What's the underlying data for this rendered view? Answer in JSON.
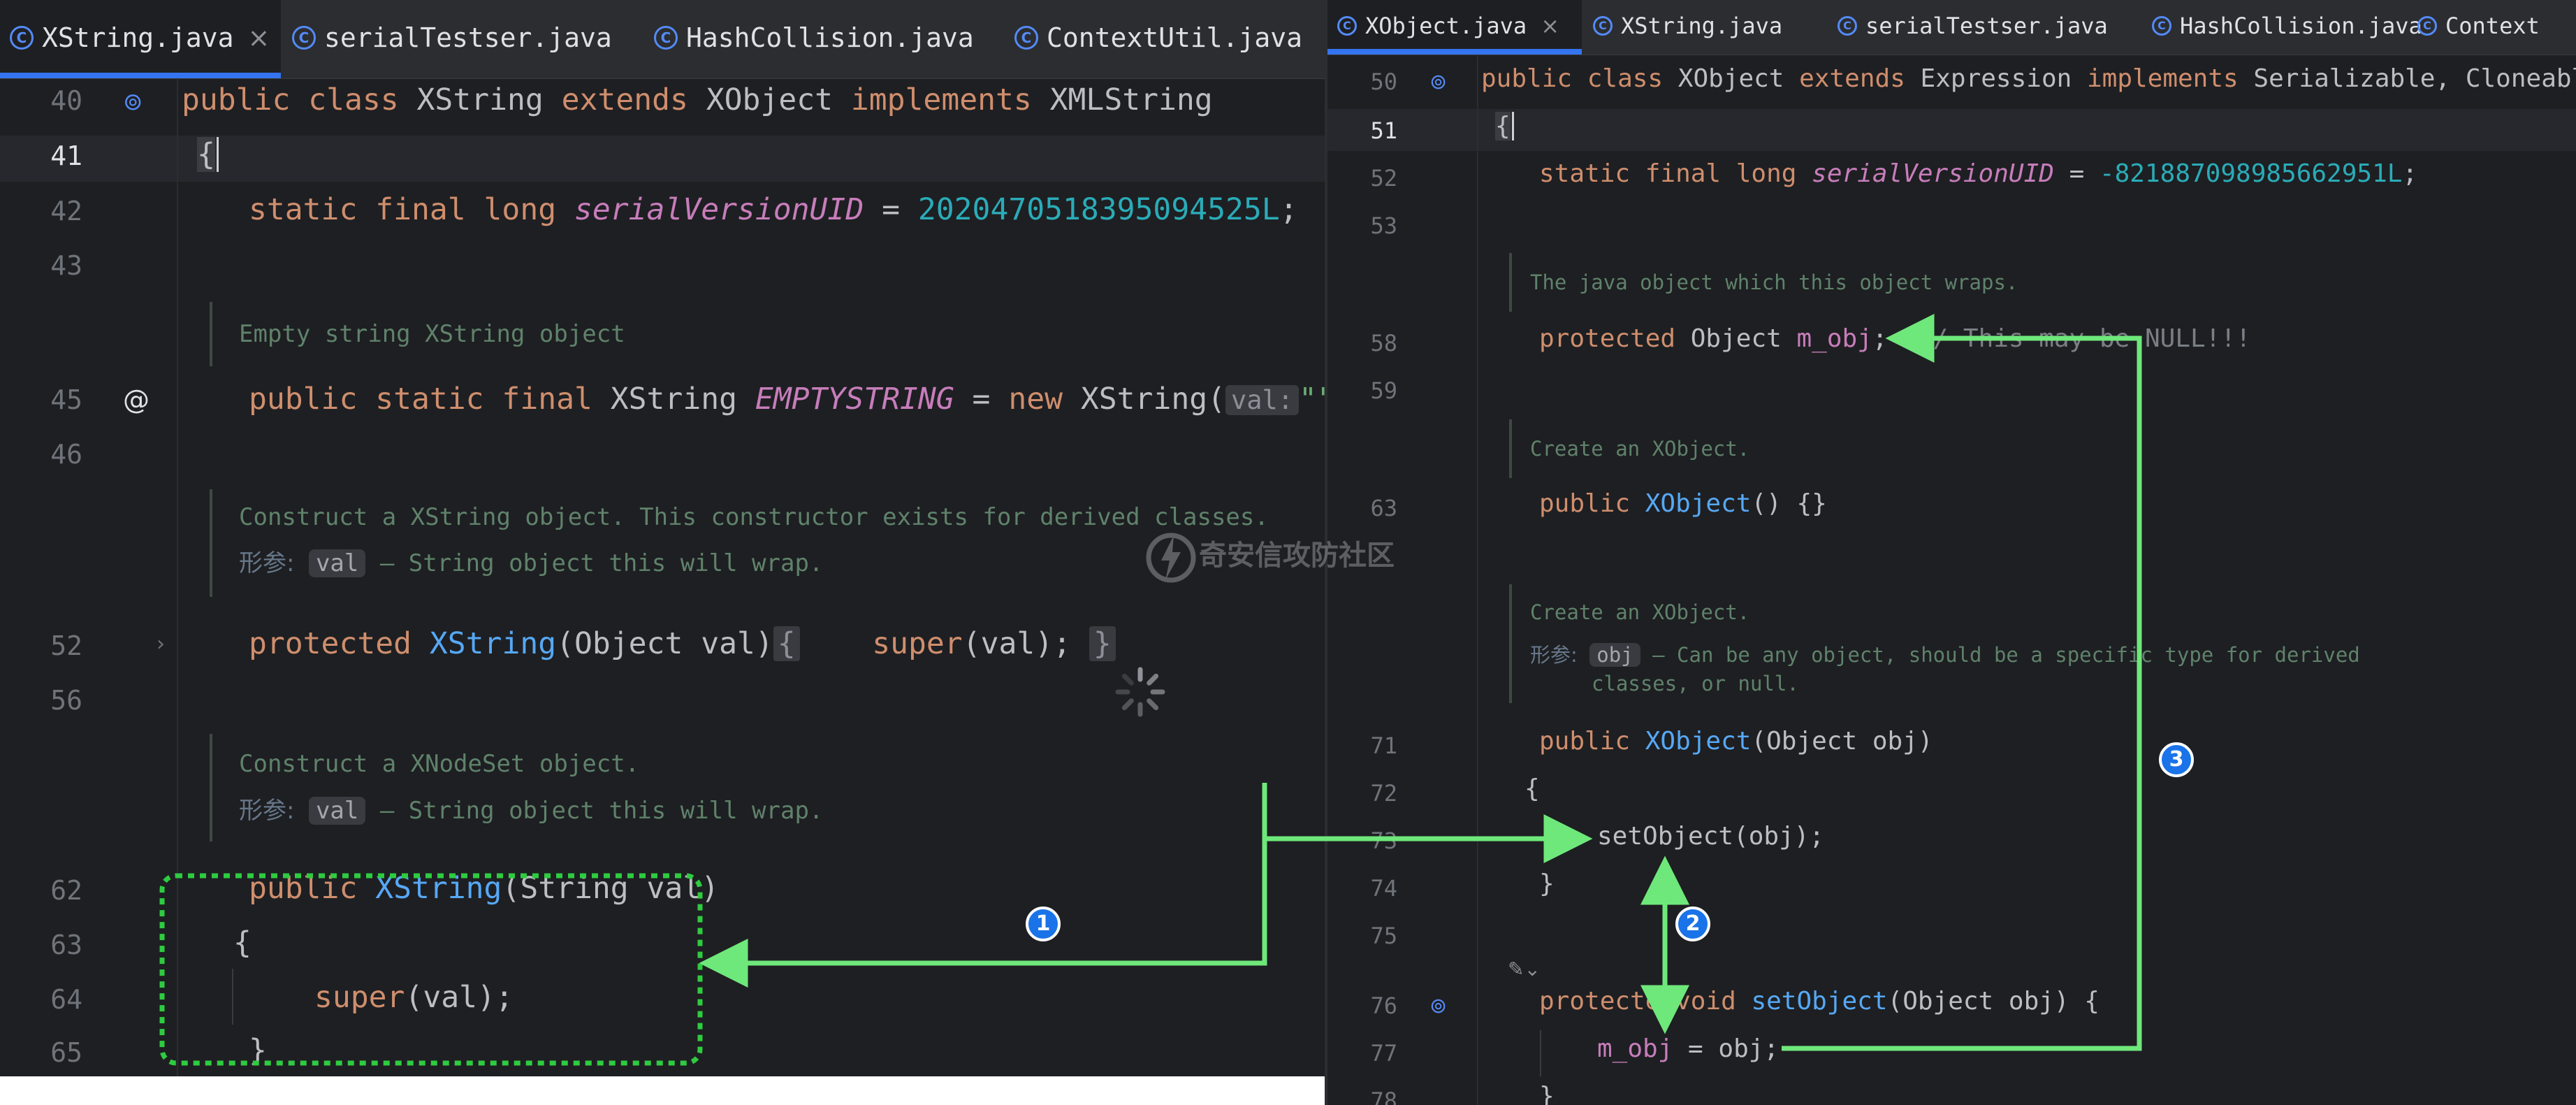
{
  "left_pane": {
    "tabs": [
      {
        "label": "XString.java",
        "icon": "class-c-icon",
        "active": true,
        "closable": true
      },
      {
        "label": "serialTestser.java",
        "icon": "class-c-icon"
      },
      {
        "label": "HashCollision.java",
        "icon": "class-c-icon"
      },
      {
        "label": "ContextUtil.java",
        "icon": "class-c-icon"
      }
    ],
    "close_symbol": "×",
    "line_numbers": [
      "40",
      "41",
      "42",
      "43",
      "45",
      "46",
      "52",
      "56",
      "62",
      "63",
      "64",
      "65"
    ],
    "code": {
      "l40": {
        "kw1": "public class ",
        "name": "XString ",
        "kw2": "extends ",
        "parent": "XObject ",
        "kw3": "implements ",
        "iface": "XMLString"
      },
      "l41": {
        "brace": "{"
      },
      "l42": {
        "kw": "static final long ",
        "field": "serialVersionUID",
        "eq": " = ",
        "num": "2020470518395094525L",
        "semi": ";"
      },
      "l45": {
        "kw1": "public static final ",
        "type": "XString ",
        "field": "EMPTYSTRING",
        "eq": " = ",
        "kw2": "new ",
        "ctor": "XString(",
        "hint": "val:",
        "str": "\"\"",
        "end": ");"
      },
      "l52": {
        "kw": "protected ",
        "fn": "XString",
        "params": "(Object val)",
        "open": "{",
        "call": "super",
        "args": "(val);",
        "close": "}"
      },
      "l62": {
        "kw": "public ",
        "fn": "XString",
        "params": "(String val)"
      },
      "l63": {
        "brace": "{"
      },
      "l64": {
        "call": "super",
        "args": "(val);"
      },
      "l65": {
        "brace": "}"
      }
    },
    "docs": {
      "empty": "Empty string XString object",
      "construct_1": "Construct a XString object. This constructor exists for derived classes.",
      "construct_2": "Construct a XNodeSet object.",
      "param_tag": "形参:",
      "param_name": "val",
      "param_desc": " – String object this will wrap."
    }
  },
  "right_pane": {
    "tabs": [
      {
        "label": "XObject.java",
        "icon": "class-c-icon",
        "active": true,
        "closable": true
      },
      {
        "label": "XString.java",
        "icon": "class-c-icon"
      },
      {
        "label": "serialTestser.java",
        "icon": "class-c-icon"
      },
      {
        "label": "HashCollision.java",
        "icon": "class-c-icon"
      },
      {
        "label": "Context",
        "icon": "class-c-icon"
      }
    ],
    "close_symbol": "×",
    "line_numbers": [
      "50",
      "51",
      "52",
      "53",
      "58",
      "59",
      "63",
      "71",
      "72",
      "73",
      "74",
      "75",
      "76",
      "77",
      "78"
    ],
    "code": {
      "l50": {
        "kw1": "public class ",
        "name": "XObject ",
        "kw2": "extends ",
        "parent": "Expression ",
        "kw3": "implements ",
        "ifaces": "Serializable, Cloneable"
      },
      "l51": {
        "brace": "{"
      },
      "l52": {
        "kw": "static final long ",
        "field": "serialVersionUID",
        "eq": " = ",
        "num": "-821887098985662951L",
        "semi": ";"
      },
      "l58": {
        "kw": "protected ",
        "type": "Object ",
        "field": "m_obj",
        "semi": ";",
        "comment": "  // This may be NULL!!!"
      },
      "l63": {
        "kw": "public ",
        "fn": "XObject",
        "rest": "() {}"
      },
      "l71": {
        "kw": "public ",
        "fn": "XObject",
        "params": "(Object obj)"
      },
      "l72": {
        "brace": "{"
      },
      "l73": {
        "call": "setObject(obj);"
      },
      "l74": {
        "brace": "}"
      },
      "l76": {
        "kw": "protecte",
        "kw2": " void ",
        "fn": "setObject",
        "params": "(Object obj) {"
      },
      "l77": {
        "field": "m_obj",
        "rest": " = obj;"
      },
      "l78": {
        "brace": "}"
      }
    },
    "docs": {
      "wraps": "The java object which this object wraps.",
      "create_1": "Create an XObject.",
      "create_2": "Create an XObject.",
      "param_tag": "形参:",
      "param_name": "obj",
      "param_desc_1": " – Can be any object, should be a specific type for derived",
      "param_desc_2": "classes, or null."
    }
  },
  "watermark": "奇安信攻防社区",
  "annotations": {
    "markers": [
      "1",
      "2",
      "3"
    ],
    "arrow_color": "#6ee87a",
    "box_color": "#2ecc40",
    "marker_color": "#1a73e8"
  }
}
